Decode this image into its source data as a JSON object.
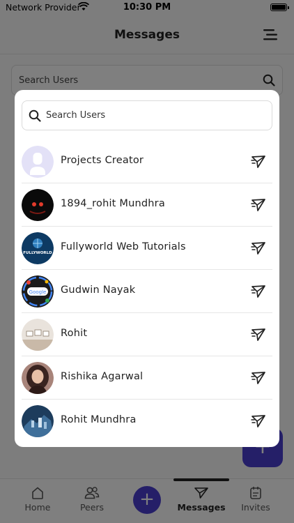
{
  "status_bar": {
    "carrier": "Network Provider",
    "time": "10:30 PM"
  },
  "header": {
    "title": "Messages",
    "menu_icon": "hamburger-menu-icon"
  },
  "background_search": {
    "placeholder": "Search Users"
  },
  "modal": {
    "search_placeholder": "Search Users",
    "users": [
      {
        "name": "Projects Creator",
        "avatar": "default-avatar"
      },
      {
        "name": "1894_rohit Mundhra",
        "avatar": "dark-avatar"
      },
      {
        "name": "Fullyworld Web Tutorials",
        "avatar": "fullyworld-logo",
        "avatar_text": "FULLYWORLD"
      },
      {
        "name": "Gudwin Nayak",
        "avatar": "google-avatar",
        "avatar_text": "Google"
      },
      {
        "name": "Rohit",
        "avatar": "room-photo-avatar"
      },
      {
        "name": "Rishika Agarwal",
        "avatar": "portrait-photo-avatar"
      },
      {
        "name": "Rohit Mundhra",
        "avatar": "city-photo-avatar"
      }
    ]
  },
  "tabs": [
    {
      "label": "Home",
      "icon": "home-icon"
    },
    {
      "label": "Peers",
      "icon": "peers-icon"
    },
    {
      "label": "Messages",
      "icon": "messages-icon",
      "active": true
    },
    {
      "label": "Invites",
      "icon": "invites-icon"
    }
  ],
  "colors": {
    "accent": "#4b3fd0",
    "overlay": "rgba(0,0,0,0.5)"
  }
}
